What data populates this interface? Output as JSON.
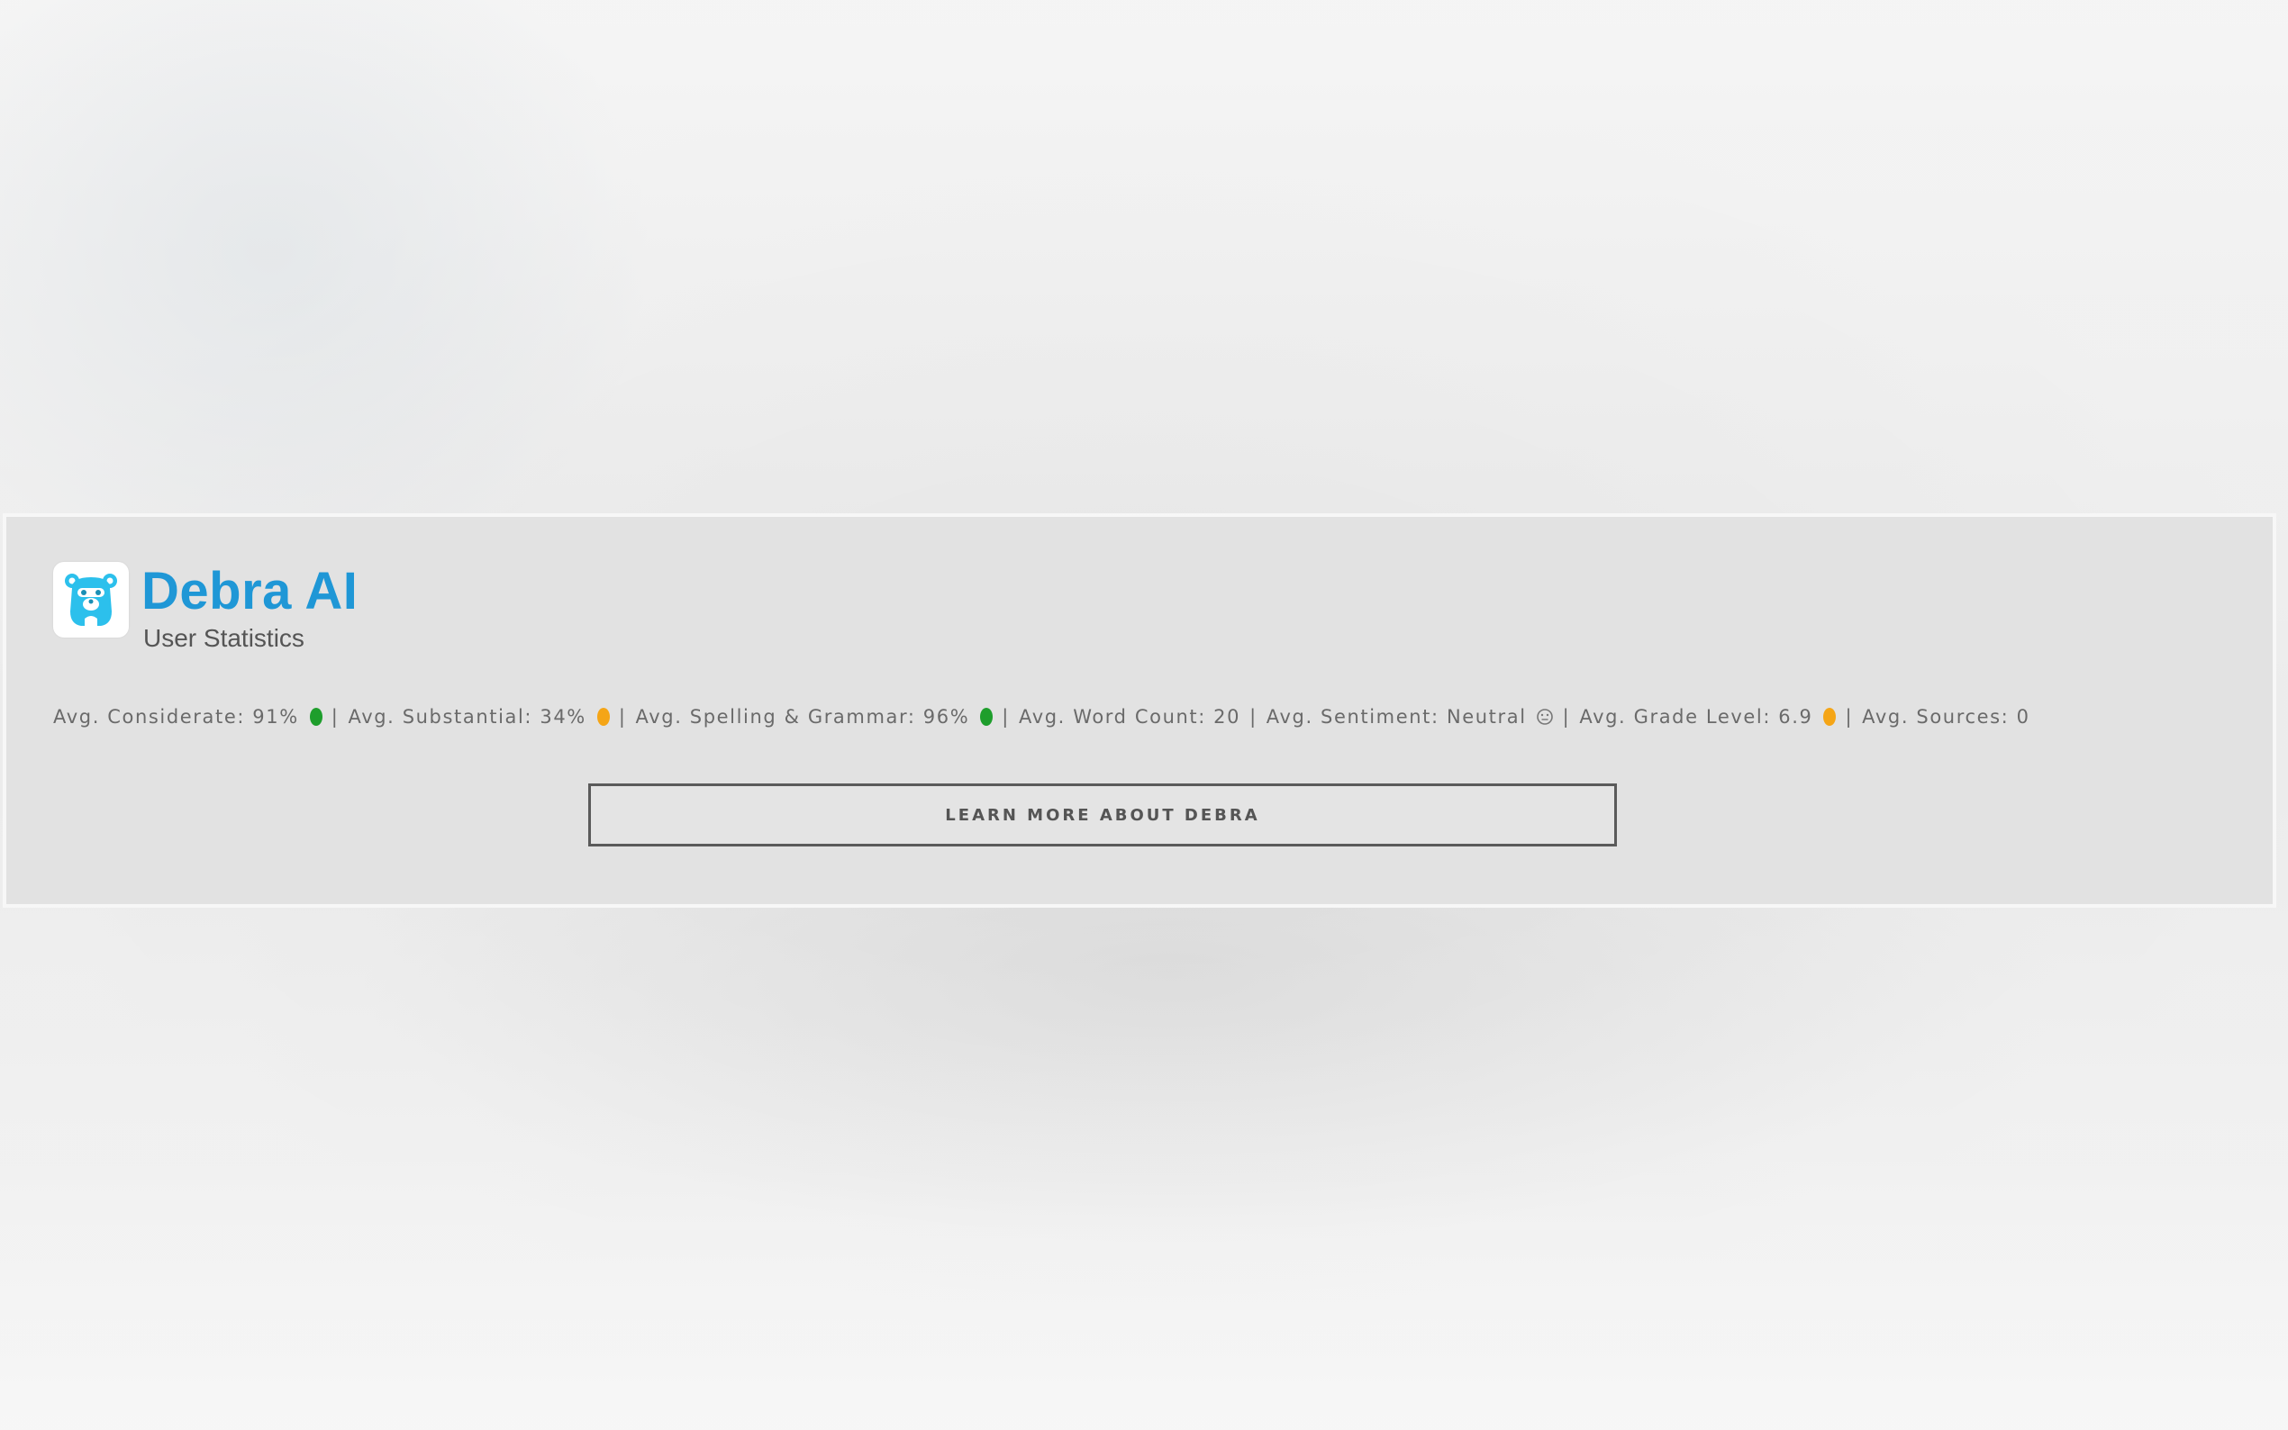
{
  "app": {
    "title": "Debra AI",
    "subtitle": "User Statistics",
    "logo_icon": "bear-icon",
    "brand_color": "#1f97d6",
    "logo_color": "#2cc0ec"
  },
  "stats": {
    "separator": "|",
    "items": [
      {
        "text": "Avg. Considerate: 91%",
        "indicator": "dot",
        "status_color": "#1e9e2c"
      },
      {
        "text": "Avg. Substantial: 34%",
        "indicator": "dot",
        "status_color": "#f5a516"
      },
      {
        "text": "Avg. Spelling & Grammar: 96%",
        "indicator": "dot",
        "status_color": "#1e9e2c"
      },
      {
        "text": "Avg. Word Count: 20",
        "indicator": "none"
      },
      {
        "text": "Avg. Sentiment: Neutral",
        "indicator": "neutral-face-icon"
      },
      {
        "text": "Avg. Grade Level: 6.9",
        "indicator": "dot",
        "status_color": "#f5a516"
      },
      {
        "text": "Avg. Sources: 0",
        "indicator": "none"
      }
    ]
  },
  "actions": {
    "learn_more_label": "LEARN MORE ABOUT DEBRA"
  }
}
